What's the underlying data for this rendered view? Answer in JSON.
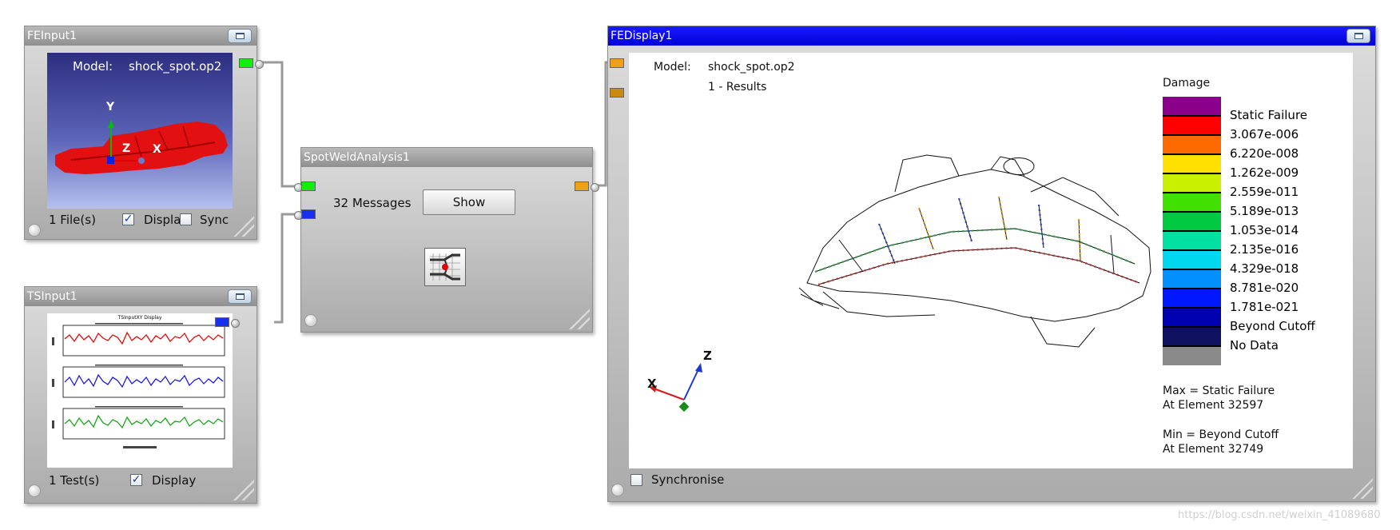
{
  "colors": {
    "title_inactive": "#a0a0a0",
    "title_active": "#0000e6",
    "port_green": "#10ee10",
    "port_blue": "#1830ee",
    "port_orange": "#f0a018",
    "model_red": "#e21010",
    "plot_red": "#e00000",
    "plot_blue": "#1010e0",
    "plot_green": "#10a010"
  },
  "fe_input": {
    "title": "FEInput1",
    "model_label": "Model:",
    "model_value": "shock_spot.op2",
    "axis_y": "Y",
    "axis_z": "Z",
    "axis_x": "X",
    "files": "1 File(s)",
    "display_label": "Displa",
    "display_checked": true,
    "sync_label": "Sync",
    "sync_checked": false
  },
  "ts_input": {
    "title": "TSInput1",
    "plot_title": "TSInputXY Display",
    "tests": "1 Test(s)",
    "display_label": "Display",
    "display_checked": true
  },
  "spotweld": {
    "title": "SpotWeldAnalysis1",
    "messages": "32 Messages",
    "show_button": "Show",
    "icon": "spotweld-analysis-icon"
  },
  "fe_display": {
    "title": "FEDisplay1",
    "model_label": "Model:",
    "model_value": "shock_spot.op2",
    "results": "1 - Results",
    "axis_z": "Z",
    "axis_x": "X",
    "legend_title": "Damage",
    "legend_colors": [
      "#8b008b",
      "#ff0000",
      "#ff6a00",
      "#ffe000",
      "#c8f000",
      "#40e000",
      "#00c840",
      "#00e0a0",
      "#00d8f0",
      "#0090ff",
      "#0018ff",
      "#0000b0",
      "#101060",
      "#8a8a8a"
    ],
    "legend_labels": [
      "Static Failure",
      "3.067e-006",
      "6.220e-008",
      "1.262e-009",
      "2.559e-011",
      "5.189e-013",
      "1.053e-014",
      "2.135e-016",
      "4.329e-018",
      "8.781e-020",
      "1.781e-021",
      "Beyond Cutoff",
      "No Data"
    ],
    "max_line1": "Max = Static Failure",
    "max_line2": "At Element 32597",
    "min_line1": "Min = Beyond Cutoff",
    "min_line2": "At Element 32749",
    "sync_label": "Synchronise",
    "sync_checked": false
  },
  "watermark": "https://blog.csdn.net/weixin_41089680"
}
